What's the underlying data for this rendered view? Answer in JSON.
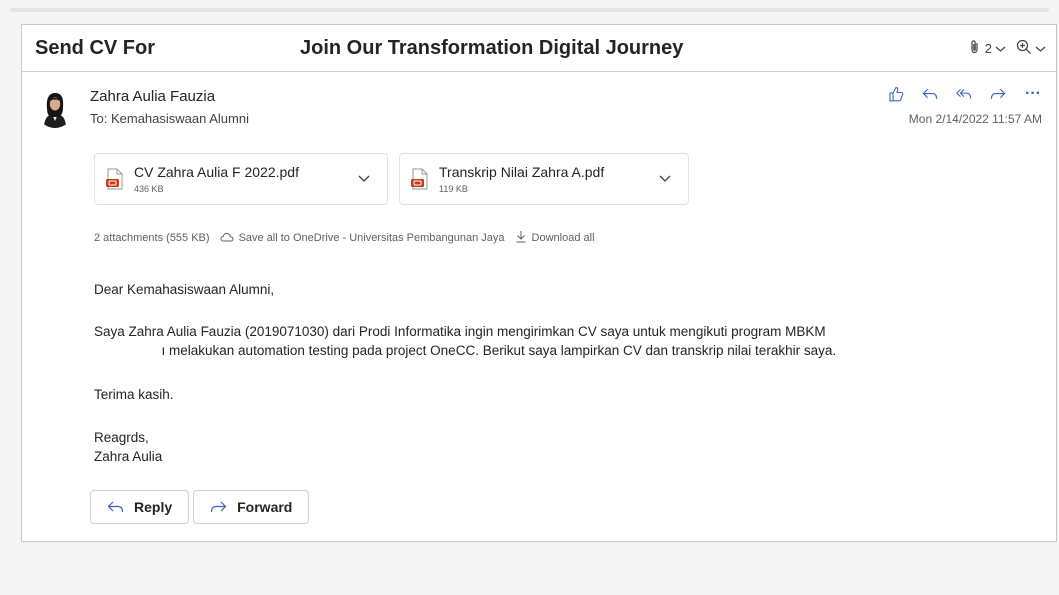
{
  "subject": {
    "prefix": "Send CV For",
    "title": "Join Our Transformation Digital Journey",
    "attachment_count": "2"
  },
  "message": {
    "sender": "Zahra Aulia Fauzia",
    "to_label": "To:",
    "to_value": "Kemahasiswaan Alumni",
    "timestamp": "Mon 2/14/2022 11:57 AM"
  },
  "attachments": [
    {
      "name": "CV Zahra Aulia F 2022.pdf",
      "size": "436 KB"
    },
    {
      "name": "Transkrip Nilai Zahra A.pdf",
      "size": "119 KB"
    }
  ],
  "attachment_summary": {
    "count_text": "2 attachments (555 KB)",
    "save_onedrive": "Save all to OneDrive - Universitas Pembangunan Jaya",
    "download_all": "Download all"
  },
  "body": {
    "greeting": "Dear Kemahasiswaan Alumni,",
    "line1": "Saya Zahra Aulia Fauzia (2019071030) dari Prodi Informatika ingin mengirimkan CV saya untuk mengikuti program MBKM",
    "line2": "\t \t​                  ı melakukan automation testing pada project OneCC. Berikut saya lampirkan CV dan transkrip nilai terakhir saya.",
    "thanks": "Terima kasih.",
    "signoff": "Reagrds,",
    "signature": "Zahra Aulia"
  },
  "buttons": {
    "reply": "Reply",
    "forward": "Forward"
  },
  "colors": {
    "accent": "#3b62c4",
    "pdf_red": "#c43e1c"
  }
}
